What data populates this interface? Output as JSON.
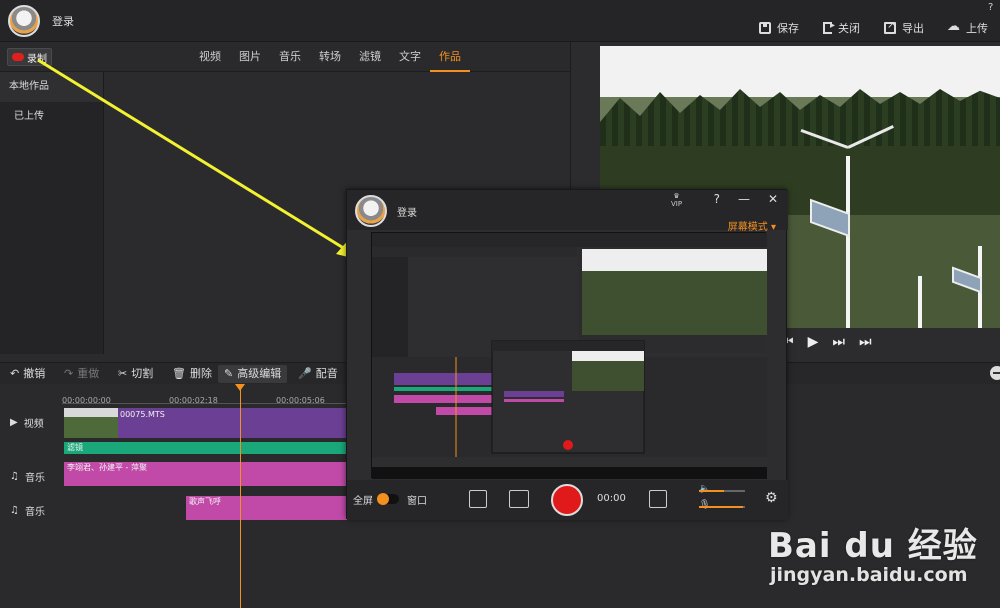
{
  "header": {
    "login": "登录",
    "help_glyph": "?",
    "actions": [
      "保存",
      "关闭",
      "导出",
      "上传"
    ]
  },
  "record_button": {
    "label": "录制"
  },
  "tabs": [
    "视频",
    "图片",
    "音乐",
    "转场",
    "滤镜",
    "文字",
    "作品"
  ],
  "active_tab": "作品",
  "sidebar": {
    "items": [
      "本地作品",
      "已上传"
    ]
  },
  "toolbar": {
    "items": [
      "撤销",
      "重做",
      "切割",
      "删除",
      "高级编辑",
      "配音"
    ]
  },
  "timeline": {
    "ticks": [
      "00:00:00:00",
      "00:00:02:18",
      "00:00:05:06"
    ],
    "tracks": [
      "视频",
      "音乐",
      "音乐"
    ],
    "clips": {
      "video": "00075.MTS",
      "filter": "滤镜",
      "music1": "李翊君、孙建平 - 萍聚",
      "music2": "歌声飞呼"
    }
  },
  "recorder": {
    "login": "登录",
    "vip": "VIP",
    "help": "?",
    "minimize": "—",
    "close": "✕",
    "mode": "屏幕模式 ▾",
    "fullscreen": "全屏",
    "window": "窗口",
    "time": "00:00",
    "volume_level": 0.55,
    "mic_level": 0.95
  },
  "watermark": {
    "logo": "Bai du 经验",
    "url": "jingyan.baidu.com"
  },
  "colors": {
    "accent": "#f39020",
    "record_red": "#e0201c",
    "video_clip": "#6b3f93",
    "filter_clip": "#1aa87a",
    "music_clip": "#c14aa9",
    "arrow": "#f2f230"
  }
}
